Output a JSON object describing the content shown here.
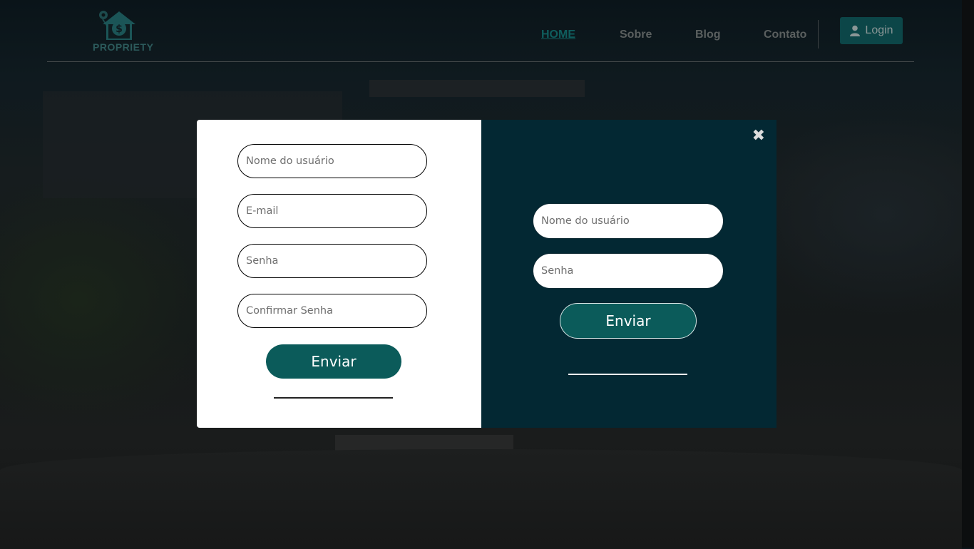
{
  "header": {
    "logo_text": "PROPRIETY",
    "nav": {
      "home": "HOME",
      "sobre": "Sobre",
      "blog": "Blog",
      "contato": "Contato"
    },
    "login_label": "Login"
  },
  "register_form": {
    "username_placeholder": "Nome do usuário",
    "email_placeholder": "E-mail",
    "password_placeholder": "Senha",
    "confirm_password_placeholder": "Confirmar Senha",
    "submit_label": "Enviar"
  },
  "login_form": {
    "username_placeholder": "Nome do usuário",
    "password_placeholder": "Senha",
    "submit_label": "Enviar",
    "close_symbol": "✖"
  },
  "colors": {
    "accent": "#0b5b5a",
    "panel_dark": "#032833",
    "nav_active": "#0f5d5d"
  },
  "icons": {
    "logo": "house-dollar-icon",
    "login": "user-icon",
    "close": "close-icon"
  }
}
